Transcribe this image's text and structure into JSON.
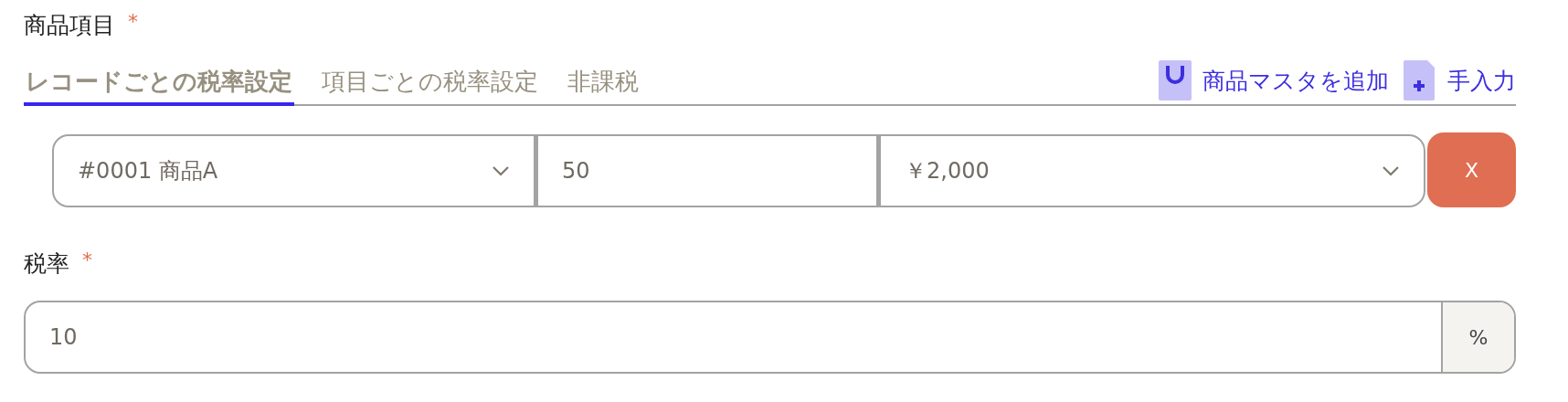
{
  "product_section": {
    "label": "商品項目",
    "required_mark": "*",
    "tabs": [
      {
        "label": "レコードごとの税率設定",
        "selected": true
      },
      {
        "label": "項目ごとの税率設定",
        "selected": false
      },
      {
        "label": "非課税",
        "selected": false
      }
    ],
    "actions": [
      {
        "kind": "master",
        "label": "商品マスタを追加"
      },
      {
        "kind": "manual",
        "label": "手入力"
      }
    ],
    "line_items": [
      {
        "product": "#0001 商品A",
        "quantity": "50",
        "price": "￥2,000",
        "delete_label": "X"
      }
    ]
  },
  "tax_section": {
    "label": "税率",
    "required_mark": "*",
    "value": "10",
    "unit": "%"
  }
}
